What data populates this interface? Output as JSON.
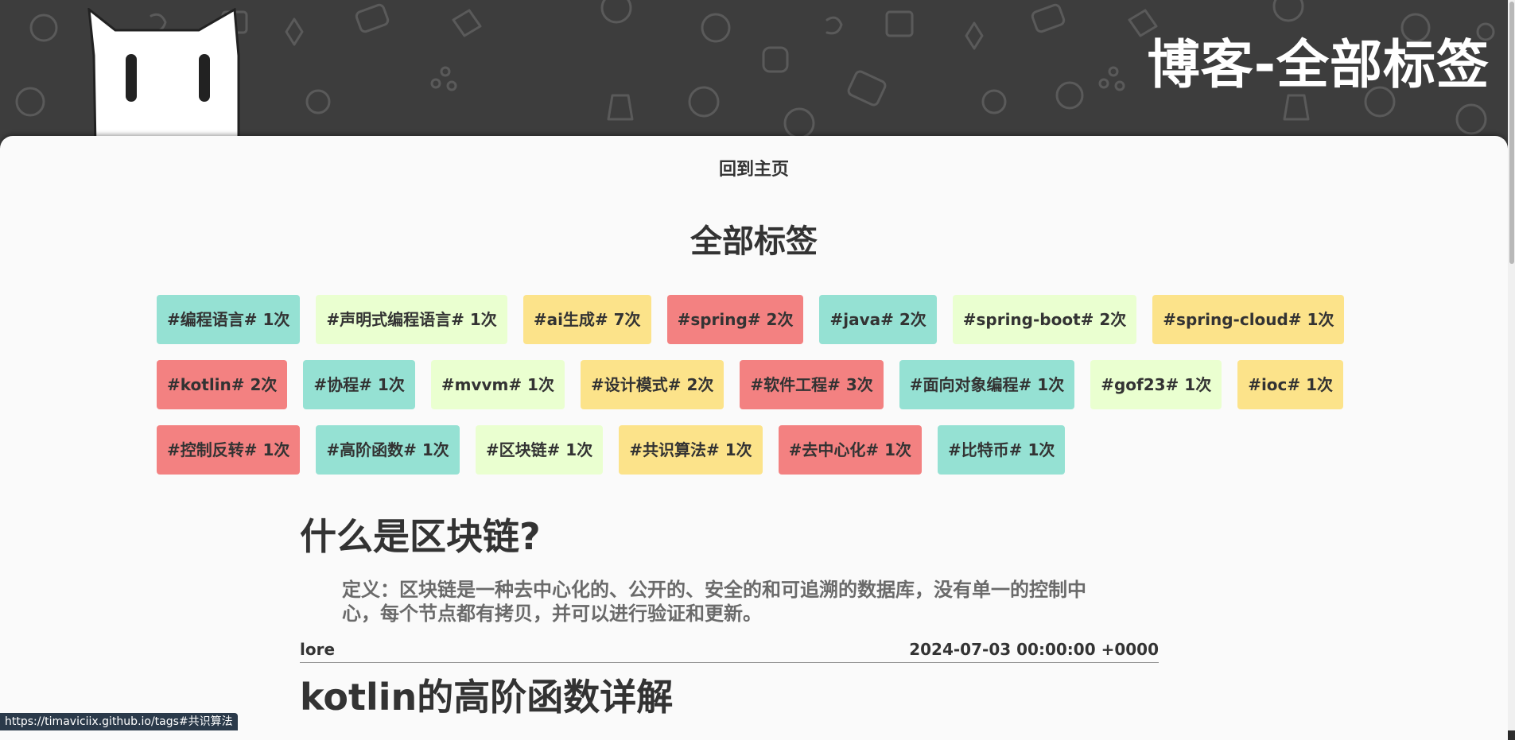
{
  "site_title": "博客-全部标签",
  "nav": {
    "home_label": "回到主页"
  },
  "page_title": "全部标签",
  "tag_rows": [
    [
      {
        "label": "#编程语言# 1次",
        "color": "#95e1d3"
      },
      {
        "label": "#声明式编程语言# 1次",
        "color": "#eaffd0"
      },
      {
        "label": "#ai生成# 7次",
        "color": "#fce38a"
      },
      {
        "label": "#spring# 2次",
        "color": "#f38181"
      },
      {
        "label": "#java# 2次",
        "color": "#95e1d3"
      },
      {
        "label": "#spring-boot# 2次",
        "color": "#eaffd0"
      },
      {
        "label": "#spring-cloud# 1次",
        "color": "#fce38a"
      }
    ],
    [
      {
        "label": "#kotlin# 2次",
        "color": "#f38181"
      },
      {
        "label": "#协程# 1次",
        "color": "#95e1d3"
      },
      {
        "label": "#mvvm# 1次",
        "color": "#eaffd0"
      },
      {
        "label": "#设计模式# 2次",
        "color": "#fce38a"
      },
      {
        "label": "#软件工程# 3次",
        "color": "#f38181"
      },
      {
        "label": "#面向对象编程# 1次",
        "color": "#95e1d3"
      },
      {
        "label": "#gof23# 1次",
        "color": "#eaffd0"
      },
      {
        "label": "#ioc# 1次",
        "color": "#fce38a"
      }
    ],
    [
      {
        "label": "#控制反转# 1次",
        "color": "#f38181"
      },
      {
        "label": "#高阶函数# 1次",
        "color": "#95e1d3"
      },
      {
        "label": "#区块链# 1次",
        "color": "#eaffd0"
      },
      {
        "label": "#共识算法# 1次",
        "color": "#fce38a"
      },
      {
        "label": "#去中心化# 1次",
        "color": "#f38181"
      },
      {
        "label": "#比特币# 1次",
        "color": "#95e1d3"
      }
    ]
  ],
  "posts": [
    {
      "title": "什么是区块链?",
      "excerpt": "定义：区块链是一种去中心化的、公开的、安全的和可追溯的数据库，没有单一的控制中心，每个节点都有拷贝，并可以进行验证和更新。",
      "author": "lore",
      "date": "2024-07-03 00:00:00 +0000"
    },
    {
      "title": "kotlin的高阶函数详解"
    }
  ],
  "status_bar": {
    "url": "https://timaviciix.github.io/tags#共识算法"
  }
}
